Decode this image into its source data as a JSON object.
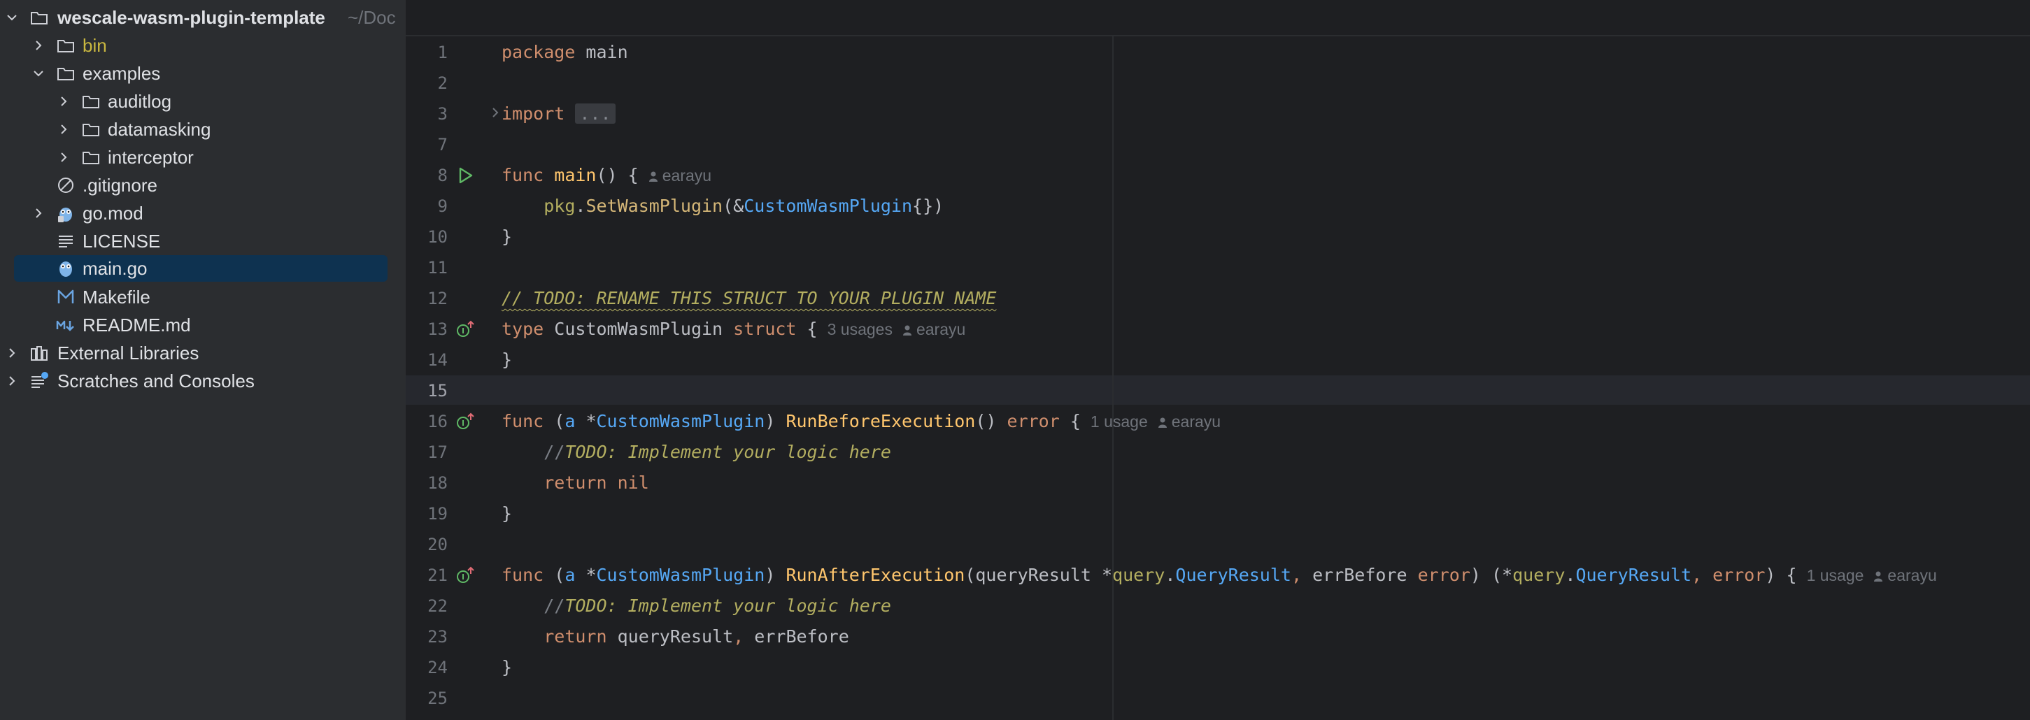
{
  "project": {
    "name": "wescale-wasm-plugin-template",
    "path": "~/Doc"
  },
  "tree": [
    {
      "label": "bin"
    },
    {
      "label": "examples"
    },
    {
      "label": "auditlog"
    },
    {
      "label": "datamasking"
    },
    {
      "label": "interceptor"
    },
    {
      "label": ".gitignore"
    },
    {
      "label": "go.mod"
    },
    {
      "label": "LICENSE"
    },
    {
      "label": "main.go",
      "selected": true
    },
    {
      "label": "Makefile"
    },
    {
      "label": "README.md"
    },
    {
      "label": "External Libraries"
    },
    {
      "label": "Scratches and Consoles"
    }
  ],
  "editor": {
    "file": "main.go",
    "current_line": 15,
    "line_numbers": [
      "1",
      "2",
      "3",
      "7",
      "8",
      "9",
      "10",
      "11",
      "12",
      "13",
      "14",
      "15",
      "16",
      "17",
      "18",
      "19",
      "20",
      "21",
      "22",
      "23",
      "24",
      "25"
    ],
    "code": {
      "l1_kw": "package",
      "l1_name": "main",
      "l3_kw": "import",
      "l3_fold": "...",
      "l8_kw": "func",
      "l8_fn": "main",
      "l8_rest": "() {",
      "l8_author": "earayu",
      "l9_pkg": "pkg",
      "l9_call": "SetWasmPlugin",
      "l9_open": "(&",
      "l9_type": "CustomWasmPlugin",
      "l9_close": "{})",
      "l10": "}",
      "l12_slashes": "// ",
      "l12_todo": "TODO: RENAME THIS STRUCT TO YOUR PLUGIN NAME",
      "l13_kw": "type",
      "l13_name": "CustomWasmPlugin",
      "l13_kw2": "struct",
      "l13_brace": "{",
      "l13_usages": "3 usages",
      "l13_author": "earayu",
      "l14": "}",
      "l16_kw": "func",
      "l16_recv": "a",
      "l16_type": "CustomWasmPlugin",
      "l16_fn": "RunBeforeExecution",
      "l16_ret": "error",
      "l16_usages": "1 usage",
      "l16_author": "earayu",
      "l17_slashes": "//",
      "l17_todo": "TODO: Implement your logic here",
      "l18_kw": "return",
      "l18_val": "nil",
      "l19": "}",
      "l21_kw": "func",
      "l21_recv": "a",
      "l21_type": "CustomWasmPlugin",
      "l21_fn": "RunAfterExecution",
      "l21_p1": "queryResult",
      "l21_pkg1": "query",
      "l21_t1": "QueryResult",
      "l21_p2": "errBefore",
      "l21_t2": "error",
      "l21_pkg2": "query",
      "l21_t3": "QueryResult",
      "l21_t4": "error",
      "l21_usages": "1 usage",
      "l21_author": "earayu",
      "l22_slashes": "//",
      "l22_todo": "TODO: Implement your logic here",
      "l23_kw": "return",
      "l23_val": "queryResult",
      "l23_val2": "errBefore",
      "l24": "}"
    }
  },
  "icons": {
    "folder": "folder-icon",
    "go_file": "go-gopher-icon",
    "text_file": "text-file-icon",
    "markdown": "markdown-icon",
    "makefile": "makefile-icon",
    "ignored": "gitignore-icon",
    "libraries": "external-libraries-icon",
    "scratches": "scratches-icon",
    "run": "run-gutter-icon",
    "implements": "implements-gutter-icon"
  },
  "colors": {
    "sidebar_bg": "#2b2d30",
    "editor_bg": "#1e1f22",
    "selection": "#0e3250",
    "keyword": "#cf8e6d",
    "function": "#ffc66d",
    "type": "#56a8f5",
    "todo": "#b3ae60",
    "run_green": "#5fb865"
  }
}
